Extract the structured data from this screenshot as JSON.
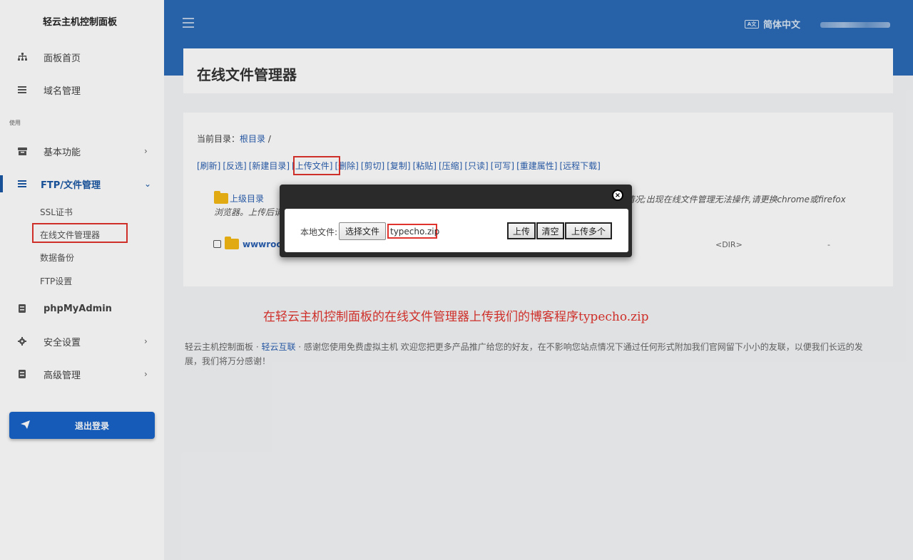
{
  "sidebar": {
    "brand": "轻云主机控制面板",
    "section_label": "使用",
    "items": [
      {
        "label": "面板首页",
        "icon": "sitemap-icon"
      },
      {
        "label": "域名管理",
        "icon": "list-icon"
      },
      {
        "label": "基本功能",
        "icon": "box-icon",
        "chevron": "›"
      },
      {
        "label": "FTP/文件管理",
        "icon": "menu-icon",
        "chevron": "⌄"
      },
      {
        "label": "phpMyAdmin",
        "icon": "database-icon"
      },
      {
        "label": "安全设置",
        "icon": "gear-icon",
        "chevron": "›"
      },
      {
        "label": "高级管理",
        "icon": "book-icon",
        "chevron": "›"
      }
    ],
    "sub_items": [
      "SSL证书",
      "在线文件管理器",
      "数据备份",
      "FTP设置"
    ],
    "logout_label": "退出登录"
  },
  "topbar": {
    "language": "简体中文",
    "language_icon_text": "A文"
  },
  "page": {
    "title": "在线文件管理器"
  },
  "file_manager": {
    "current_dir_label": "当前目录：",
    "root_label": "根目录",
    "separator": " /",
    "toolbar": [
      "[刷新]",
      "[反选]",
      "[新建目录]",
      "[上传文件]",
      "[删除]",
      "[剪切]",
      "[复制]",
      "[粘贴]",
      "[压缩]",
      "[只读]",
      "[可写]",
      "[重建属性]",
      "[远程下载]"
    ],
    "parent_label": "上级目录",
    "notice_line1": "wwwroot目录为网站目录,请勿随意删除否则会出现丢失网站程序或改变网站无法访问等情况;出现在线文件管理无法操作,请更换chrome或firefox",
    "notice_line2": "浏览器。上传后请",
    "row_name": "wwwroot",
    "row_type": "<DIR>",
    "row_size": "-"
  },
  "upload_modal": {
    "local_file_label": "本地文件:",
    "choose_file_label": "选择文件",
    "file_name": "typecho.zip",
    "upload_label": "上传",
    "clear_label": "清空",
    "upload_multi_label": "上传多个",
    "close_symbol": "×"
  },
  "caption": "在轻云主机控制面板的在线文件管理器上传我们的博客程序typecho.zip",
  "footer": {
    "text1": "轻云主机控制面板 · ",
    "link": "轻云互联",
    "text2": " · 感谢您使用免费虚拟主机 欢迎您把更多产品推广给您的好友，在不影响您站点情况下通过任何形式附加我们官网留下小小的友联，以便我们长远的发展，我们将万分感谢！"
  },
  "colors": {
    "primary": "#2b6bb8",
    "accent": "#1763c7",
    "highlight": "#e0332d"
  }
}
